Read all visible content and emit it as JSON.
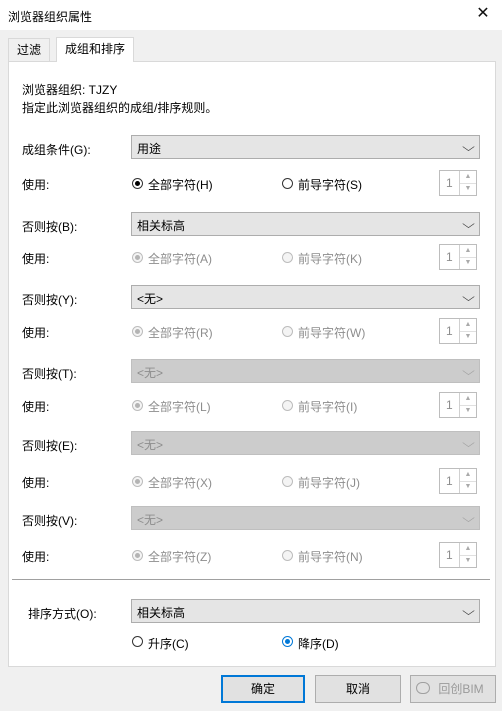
{
  "window": {
    "title": "浏览器组织属性",
    "close_glyph": "✕"
  },
  "tabs": [
    {
      "label": "过滤"
    },
    {
      "label": "成组和排序"
    }
  ],
  "header": {
    "org_line": "浏览器组织: TJZY",
    "desc_line": "指定此浏览器组织的成组/排序规则。"
  },
  "groups": [
    {
      "label": "成组条件(G):",
      "combo": "用途",
      "use_label": "使用:",
      "opt_all": "全部字符(H)",
      "opt_lead": "前导字符(S)",
      "spin": "1",
      "disabled": false
    },
    {
      "label": "否则按(B):",
      "combo": "相关标高",
      "use_label": "使用:",
      "opt_all": "全部字符(A)",
      "opt_lead": "前导字符(K)",
      "spin": "1",
      "disabled": false
    },
    {
      "label": "否则按(Y):",
      "combo": "<无>",
      "use_label": "使用:",
      "opt_all": "全部字符(R)",
      "opt_lead": "前导字符(W)",
      "spin": "1",
      "disabled": false
    },
    {
      "label": "否则按(T):",
      "combo": "<无>",
      "use_label": "使用:",
      "opt_all": "全部字符(L)",
      "opt_lead": "前导字符(I)",
      "spin": "1",
      "disabled": true
    },
    {
      "label": "否则按(E):",
      "combo": "<无>",
      "use_label": "使用:",
      "opt_all": "全部字符(X)",
      "opt_lead": "前导字符(J)",
      "spin": "1",
      "disabled": true
    },
    {
      "label": "否则按(V):",
      "combo": "<无>",
      "use_label": "使用:",
      "opt_all": "全部字符(Z)",
      "opt_lead": "前导字符(N)",
      "spin": "1",
      "disabled": true
    }
  ],
  "sort": {
    "label": "排序方式(O):",
    "combo": "相关标高",
    "asc": "升序(C)",
    "desc": "降序(D)"
  },
  "buttons": {
    "ok": "确定",
    "cancel": "取消"
  },
  "watermark": "回创BIM"
}
